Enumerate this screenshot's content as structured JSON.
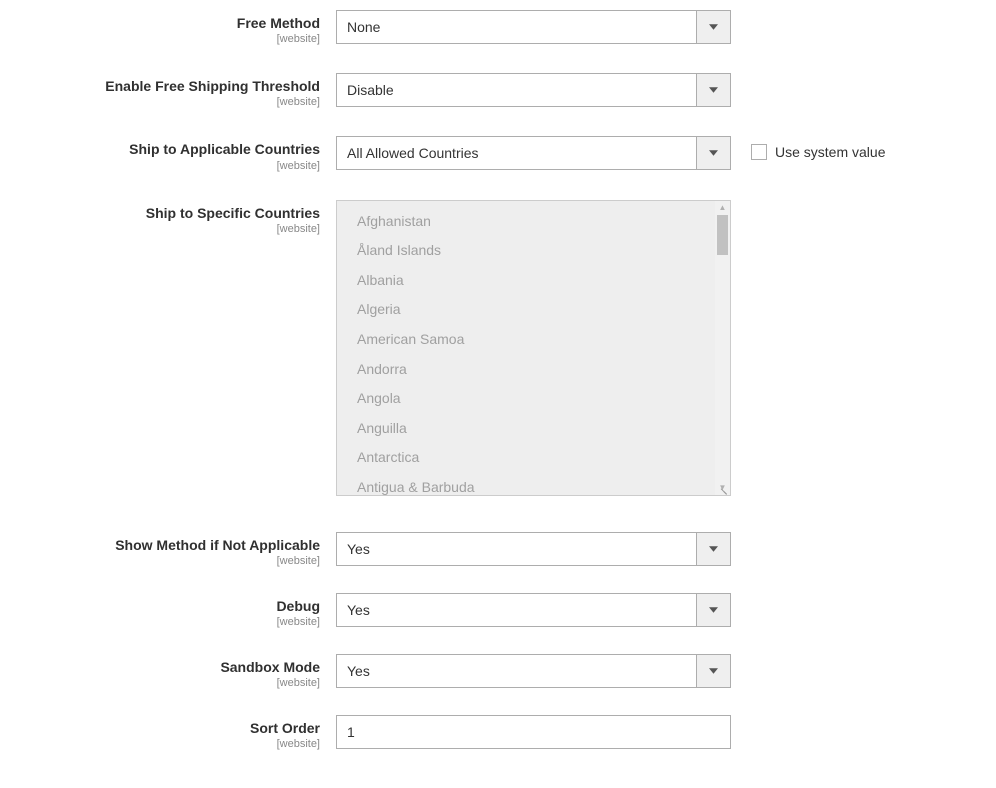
{
  "scopeText": "[website]",
  "fields": {
    "freeMethod": {
      "label": "Free Method",
      "value": "None"
    },
    "freeShippingThreshold": {
      "label": "Enable Free Shipping Threshold",
      "value": "Disable"
    },
    "shipApplicable": {
      "label": "Ship to Applicable Countries",
      "value": "All Allowed Countries"
    },
    "shipSpecific": {
      "label": "Ship to Specific Countries",
      "options": [
        "Afghanistan",
        "Åland Islands",
        "Albania",
        "Algeria",
        "American Samoa",
        "Andorra",
        "Angola",
        "Anguilla",
        "Antarctica",
        "Antigua & Barbuda"
      ]
    },
    "showMethod": {
      "label": "Show Method if Not Applicable",
      "value": "Yes"
    },
    "debug": {
      "label": "Debug",
      "value": "Yes"
    },
    "sandbox": {
      "label": "Sandbox Mode",
      "value": "Yes"
    },
    "sortOrder": {
      "label": "Sort Order",
      "value": "1"
    }
  },
  "useSystemValueLabel": "Use system value"
}
